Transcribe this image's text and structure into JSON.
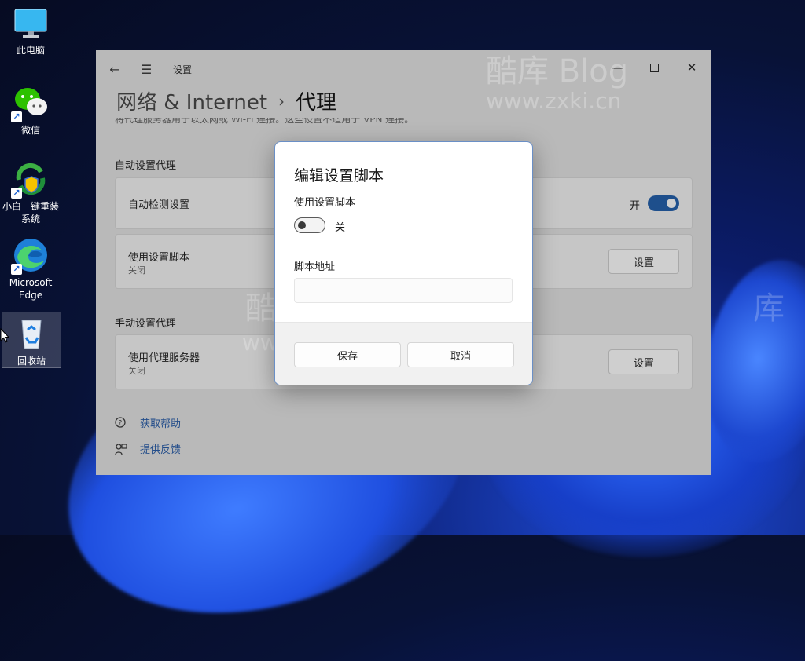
{
  "desktop": {
    "icons": [
      {
        "label": "此电脑",
        "icon": "monitor-icon"
      },
      {
        "label": "微信",
        "icon": "wechat-icon"
      },
      {
        "label": "小白一键重装系统",
        "icon": "reinstall-icon"
      },
      {
        "label": "Microsoft Edge",
        "icon": "edge-icon"
      },
      {
        "label": "回收站",
        "icon": "recycle-bin-icon"
      }
    ]
  },
  "window": {
    "title": "设置",
    "breadcrumb": {
      "parent": "网络 & Internet",
      "separator": "›",
      "current": "代理"
    },
    "description": "将代理服务器用于以太网或 Wi-Fi 连接。这些设置不适用于 VPN 连接。",
    "auto_section": {
      "title": "自动设置代理",
      "auto_detect": {
        "label": "自动检测设置",
        "state_text": "开",
        "on": true
      },
      "use_script": {
        "label": "使用设置脚本",
        "sub": "关闭",
        "button": "设置"
      }
    },
    "manual_section": {
      "title": "手动设置代理",
      "use_proxy": {
        "label": "使用代理服务器",
        "sub": "关闭",
        "button": "设置"
      }
    },
    "links": {
      "help": "获取帮助",
      "feedback": "提供反馈"
    }
  },
  "dialog": {
    "title": "编辑设置脚本",
    "script_label": "使用设置脚本",
    "toggle_text": "关",
    "toggle_on": false,
    "address_label": "脚本地址",
    "address_value": "",
    "save": "保存",
    "cancel": "取消"
  },
  "watermarks": {
    "brand": "酷库 Blog",
    "url": "www.zxki.cn",
    "char": "库"
  },
  "colors": {
    "accent": "#1e4f8c",
    "link": "#234d8a"
  }
}
